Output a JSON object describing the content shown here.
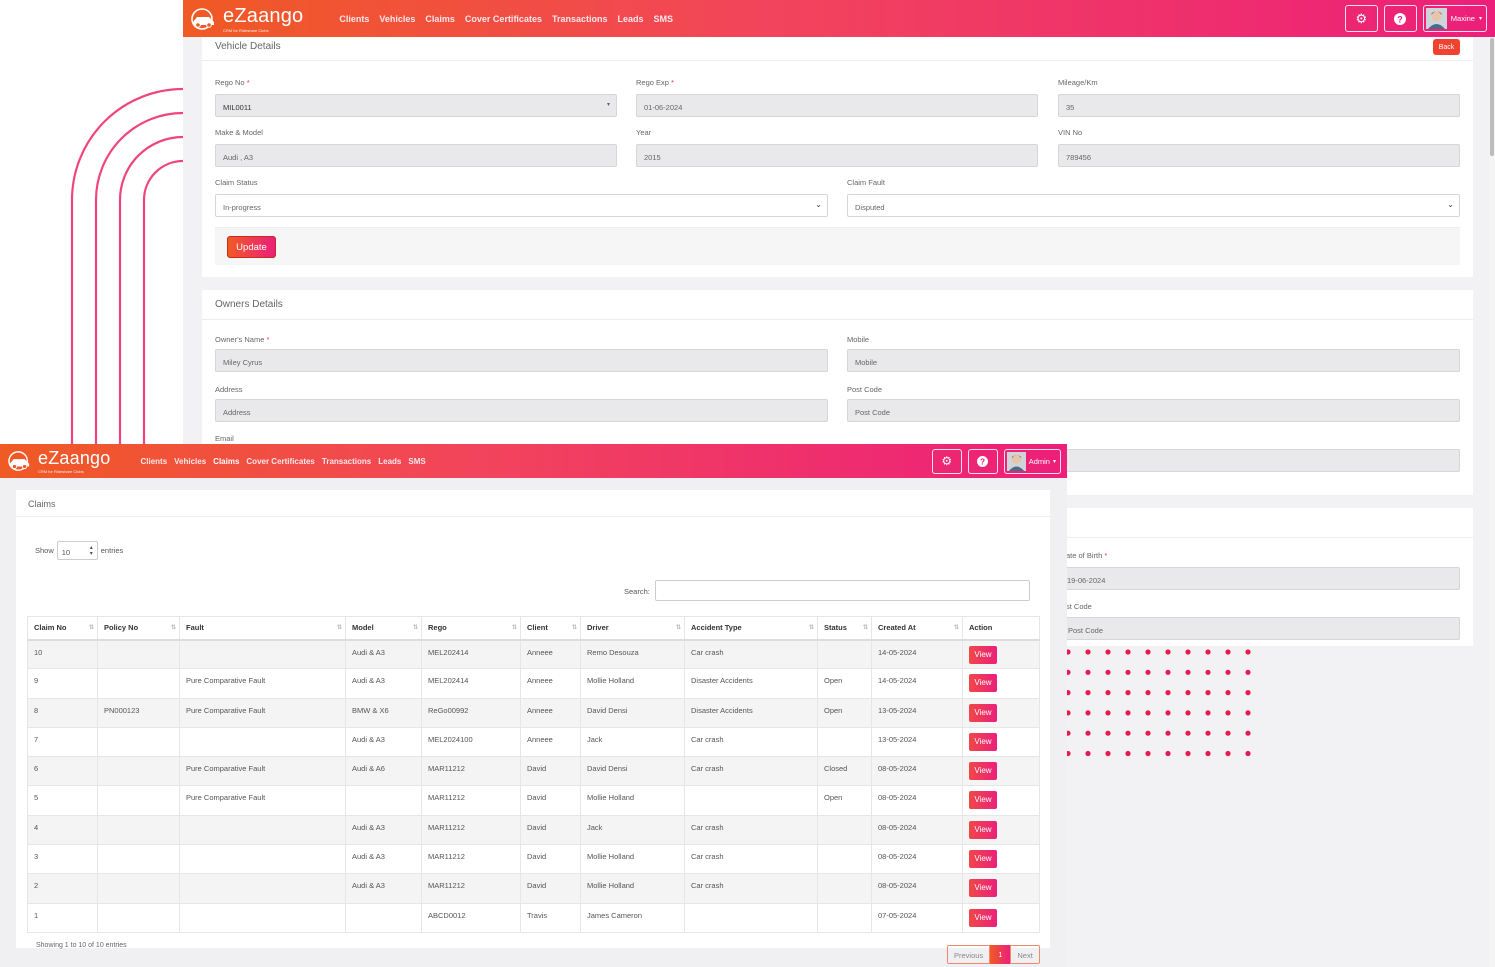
{
  "back_window": {
    "brand": {
      "name": "eZaango",
      "tagline": "CRM for Rideshare Clubs"
    },
    "nav": [
      "Clients",
      "Vehicles",
      "Claims",
      "Cover Certificates",
      "Transactions",
      "Leads",
      "SMS"
    ],
    "user": "Maxine",
    "vehicle_details": {
      "title": "Vehicle Details",
      "back_label": "Back",
      "rego_no": {
        "label": "Rego No",
        "value": "MIL0011"
      },
      "rego_exp": {
        "label": "Rego Exp",
        "value": "01-06-2024"
      },
      "mileage": {
        "label": "Mileage/Km",
        "value": "35"
      },
      "make_model": {
        "label": "Make & Model",
        "value": "Audi , A3"
      },
      "year": {
        "label": "Year",
        "value": "2015"
      },
      "vin": {
        "label": "VIN No",
        "value": "789456"
      },
      "claim_status": {
        "label": "Claim Status",
        "value": "In-progress"
      },
      "claim_fault": {
        "label": "Claim Fault",
        "value": "Disputed"
      },
      "update_label": "Update"
    },
    "owners_details": {
      "title": "Owners Details",
      "owner_name": {
        "label": "Owner's Name",
        "value": "Miley Cyrus"
      },
      "mobile": {
        "label": "Mobile",
        "placeholder": "Mobile"
      },
      "address": {
        "label": "Address",
        "placeholder": "Address"
      },
      "post_code": {
        "label": "Post Code",
        "placeholder": "Post Code"
      },
      "email": {
        "label": "Email"
      }
    },
    "driver": {
      "dob_label": "ate of Birth",
      "dob_value": "19-06-2024",
      "postcode_label": "st Code",
      "postcode_placeholder": "Post Code"
    }
  },
  "front_window": {
    "brand": {
      "name": "eZaango",
      "tagline": "CRM for Rideshare Clubs"
    },
    "nav": [
      "Clients",
      "Vehicles",
      "Claims",
      "Cover Certificates",
      "Transactions",
      "Leads",
      "SMS"
    ],
    "active_nav": "Claims",
    "user": "Admin",
    "claims": {
      "title": "Claims",
      "show_label": "Show",
      "entries_value": "10",
      "entries_label": "entries",
      "search_label": "Search:",
      "columns": [
        "Claim No",
        "Policy No",
        "Fault",
        "Model",
        "Rego",
        "Client",
        "Driver",
        "Accident Type",
        "Status",
        "Created At",
        "Action"
      ],
      "rows": [
        [
          "10",
          "",
          "",
          "Audi & A3",
          "MEL202414",
          "Anneee",
          "Remo Desouza",
          "Car crash",
          "",
          "14-05-2024"
        ],
        [
          "9",
          "",
          "Pure Comparative Fault",
          "Audi & A3",
          "MEL202414",
          "Anneee",
          "Mollie Holland",
          "Disaster Accidents",
          "Open",
          "14-05-2024"
        ],
        [
          "8",
          "PN000123",
          "Pure Comparative Fault",
          "BMW & X6",
          "ReGo00992",
          "Anneee",
          "David Densi",
          "Disaster Accidents",
          "Open",
          "13-05-2024"
        ],
        [
          "7",
          "",
          "",
          "Audi & A3",
          "MEL2024100",
          "Anneee",
          "Jack",
          "Car crash",
          "",
          "13-05-2024"
        ],
        [
          "6",
          "",
          "Pure Comparative Fault",
          "Audi & A6",
          "MAR11212",
          "David",
          "David Densi",
          "Car crash",
          "Closed",
          "08-05-2024"
        ],
        [
          "5",
          "",
          "Pure Comparative Fault",
          "",
          "MAR11212",
          "David",
          "Mollie Holland",
          "",
          "Open",
          "08-05-2024"
        ],
        [
          "4",
          "",
          "",
          "Audi & A3",
          "MAR11212",
          "David",
          "Jack",
          "Car crash",
          "",
          "08-05-2024"
        ],
        [
          "3",
          "",
          "",
          "Audi & A3",
          "MAR11212",
          "David",
          "Mollie Holland",
          "Car crash",
          "",
          "08-05-2024"
        ],
        [
          "2",
          "",
          "",
          "Audi & A3",
          "MAR11212",
          "David",
          "Mollie Holland",
          "Car crash",
          "",
          "08-05-2024"
        ],
        [
          "1",
          "",
          "",
          "",
          "ABCD0012",
          "Travis",
          "James Cameron",
          "",
          "",
          "07-05-2024"
        ]
      ],
      "view_label": "View",
      "info": "Showing 1 to 10 of 10 entries",
      "pagination": {
        "previous": "Previous",
        "current": "1",
        "next": "Next"
      }
    }
  },
  "colors": {
    "gradient_start": "#f05a24",
    "gradient_end": "#ec1f7a",
    "accent_red": "#e8194f"
  }
}
